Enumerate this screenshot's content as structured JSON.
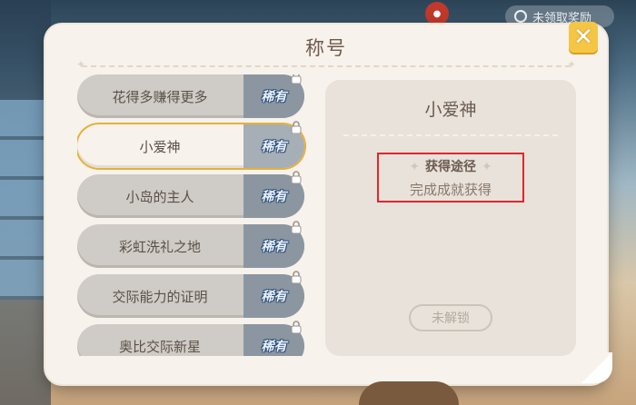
{
  "modal": {
    "title": "称号",
    "close_label": "✕"
  },
  "titles": [
    {
      "label": "花得多赚得更多",
      "tag": "稀有",
      "selected": false
    },
    {
      "label": "小爱神",
      "tag": "稀有",
      "selected": true
    },
    {
      "label": "小岛的主人",
      "tag": "稀有",
      "selected": false
    },
    {
      "label": "彩虹洗礼之地",
      "tag": "稀有",
      "selected": false
    },
    {
      "label": "交际能力的证明",
      "tag": "稀有",
      "selected": false
    },
    {
      "label": "奥比交际新星",
      "tag": "稀有",
      "selected": false
    }
  ],
  "detail": {
    "title": "小爱神",
    "acquire_heading": "获得途径",
    "acquire_text": "完成成就获得",
    "status_button": "未解锁"
  },
  "hud": {
    "top_pill_text": "未领取奖励"
  },
  "colors": {
    "panel_bg": "#f7f2eb",
    "selected_border": "#e4b23b",
    "rare_tag_bg": "#8b96a0",
    "close_button": "#f5c646",
    "highlight_box": "#e2262b"
  }
}
